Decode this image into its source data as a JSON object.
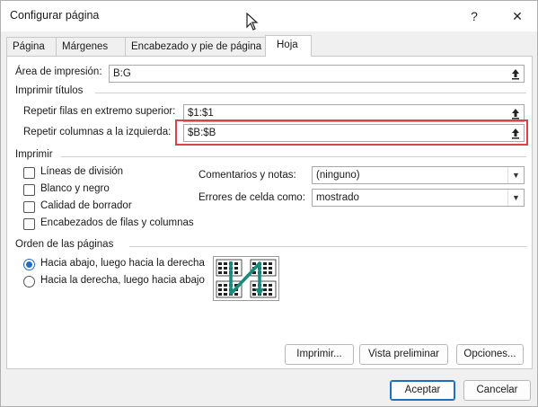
{
  "window": {
    "title": "Configurar página",
    "help_label": "?",
    "close_label": "✕"
  },
  "tabs": [
    {
      "label": "Página"
    },
    {
      "label": "Márgenes"
    },
    {
      "label": "Encabezado y pie de página"
    },
    {
      "label": "Hoja",
      "active": true
    }
  ],
  "print_area": {
    "label": "Área de impresión:",
    "value": "B:G"
  },
  "print_titles": {
    "group_label": "Imprimir títulos",
    "rows_label": "Repetir filas en extremo superior:",
    "rows_value": "$1:$1",
    "cols_label": "Repetir columnas a la izquierda:",
    "cols_value": "$B:$B"
  },
  "print": {
    "group_label": "Imprimir",
    "checkboxes": [
      {
        "label": "Líneas de división",
        "checked": false
      },
      {
        "label": "Blanco y negro",
        "checked": false
      },
      {
        "label": "Calidad de borrador",
        "checked": false
      },
      {
        "label": "Encabezados de filas y columnas",
        "checked": false
      }
    ],
    "comments_label": "Comentarios y notas:",
    "comments_value": "(ninguno)",
    "errors_label": "Errores de celda como:",
    "errors_value": "mostrado"
  },
  "page_order": {
    "group_label": "Orden de las páginas",
    "options": [
      {
        "label": "Hacia abajo, luego hacia la derecha",
        "selected": true
      },
      {
        "label": "Hacia la derecha, luego hacia abajo",
        "selected": false
      }
    ]
  },
  "buttons": {
    "print": "Imprimir...",
    "preview": "Vista preliminar",
    "options": "Opciones...",
    "accept": "Aceptar",
    "cancel": "Cancelar"
  },
  "colors": {
    "accent": "#1f6fbf",
    "highlight_border": "#d9424c",
    "order_arrow": "#1a8a7a"
  }
}
